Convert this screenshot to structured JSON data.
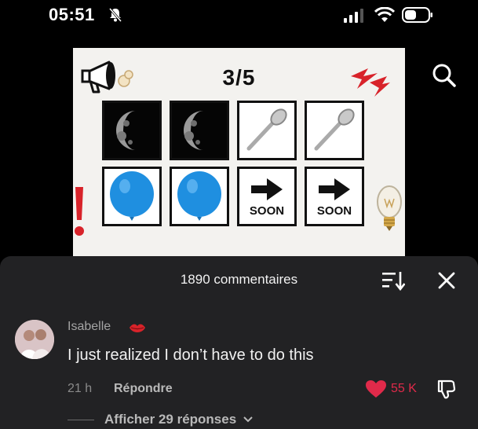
{
  "status_bar": {
    "time": "05:51"
  },
  "card": {
    "page_counter": "3/5",
    "grid": [
      [
        "moon",
        "moon",
        "spoon",
        "spoon"
      ],
      [
        "balloon",
        "balloon",
        "arrow-soon",
        "arrow-soon"
      ]
    ],
    "soon_label": "SOON"
  },
  "comments": {
    "title": "1890 commentaires",
    "comment": {
      "author": "Isabelle",
      "text": "I just realized I don’t have to do this",
      "time": "21 h",
      "reply_label": "Répondre",
      "likes": "55 K",
      "view_replies": "Afficher 29 réponses"
    }
  },
  "colors": {
    "like": "#e02a4a",
    "panel": "#222224",
    "accent_red": "#d8232a",
    "balloon": "#1f8fe0"
  }
}
